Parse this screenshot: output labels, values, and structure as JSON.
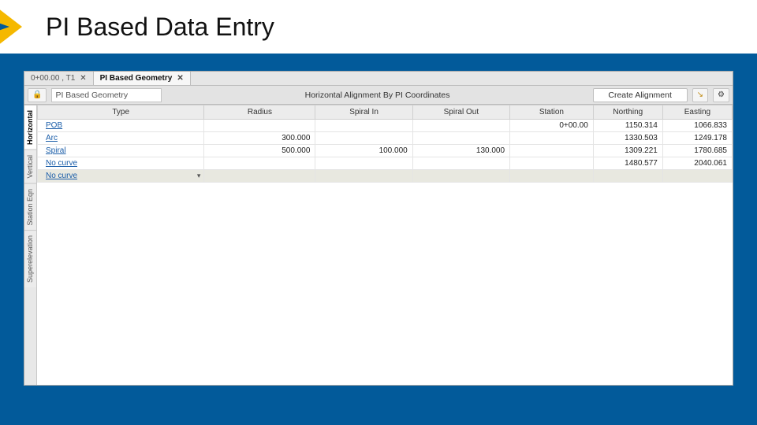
{
  "slide": {
    "title": "PI Based Data Entry"
  },
  "tabs": [
    {
      "label": "0+00.00 , T1",
      "active": false
    },
    {
      "label": "PI Based Geometry",
      "active": true
    }
  ],
  "toolbar": {
    "lock_tooltip": "Lock",
    "geometry_name": "PI Based Geometry",
    "center_label": "Horizontal Alignment By PI Coordinates",
    "create_label": "Create Alignment",
    "move_tooltip": "Move",
    "settings_tooltip": "Settings"
  },
  "sidetabs": [
    {
      "label": "Horizontal",
      "active": true
    },
    {
      "label": "Vertical",
      "active": false
    },
    {
      "label": "Station Eqn",
      "active": false
    },
    {
      "label": "Superelevation",
      "active": false
    }
  ],
  "columns": [
    "Type",
    "Radius",
    "Spiral In",
    "Spiral Out",
    "Station",
    "Northing",
    "Easting"
  ],
  "rows": [
    {
      "type": "POB",
      "radius": "",
      "spiral_in": "",
      "spiral_out": "",
      "station": "0+00.00",
      "northing": "1150.314",
      "easting": "1066.833"
    },
    {
      "type": "Arc",
      "radius": "300.000",
      "spiral_in": "",
      "spiral_out": "",
      "station": "",
      "northing": "1330.503",
      "easting": "1249.178"
    },
    {
      "type": "Spiral",
      "radius": "500.000",
      "spiral_in": "100.000",
      "spiral_out": "130.000",
      "station": "",
      "northing": "1309.221",
      "easting": "1780.685"
    },
    {
      "type": "No curve",
      "radius": "",
      "spiral_in": "",
      "spiral_out": "",
      "station": "",
      "northing": "1480.577",
      "easting": "2040.061"
    },
    {
      "type": "No curve",
      "radius": "",
      "spiral_in": "",
      "spiral_out": "",
      "station": "",
      "northing": "",
      "easting": "",
      "highlight": true
    }
  ]
}
